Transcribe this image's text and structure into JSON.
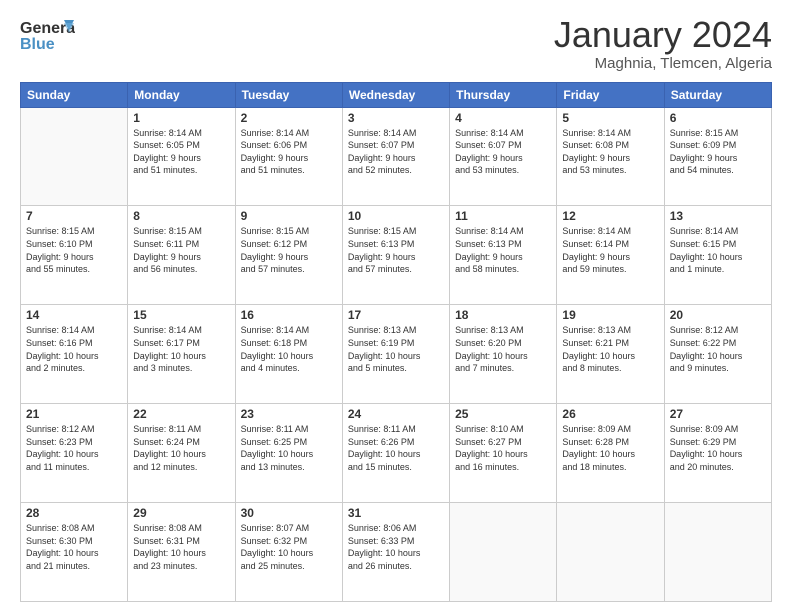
{
  "header": {
    "logo_line1": "General",
    "logo_line2": "Blue",
    "month_title": "January 2024",
    "location": "Maghnia, Tlemcen, Algeria"
  },
  "days_of_week": [
    "Sunday",
    "Monday",
    "Tuesday",
    "Wednesday",
    "Thursday",
    "Friday",
    "Saturday"
  ],
  "weeks": [
    [
      {
        "day": "",
        "info": ""
      },
      {
        "day": "1",
        "info": "Sunrise: 8:14 AM\nSunset: 6:05 PM\nDaylight: 9 hours\nand 51 minutes."
      },
      {
        "day": "2",
        "info": "Sunrise: 8:14 AM\nSunset: 6:06 PM\nDaylight: 9 hours\nand 51 minutes."
      },
      {
        "day": "3",
        "info": "Sunrise: 8:14 AM\nSunset: 6:07 PM\nDaylight: 9 hours\nand 52 minutes."
      },
      {
        "day": "4",
        "info": "Sunrise: 8:14 AM\nSunset: 6:07 PM\nDaylight: 9 hours\nand 53 minutes."
      },
      {
        "day": "5",
        "info": "Sunrise: 8:14 AM\nSunset: 6:08 PM\nDaylight: 9 hours\nand 53 minutes."
      },
      {
        "day": "6",
        "info": "Sunrise: 8:15 AM\nSunset: 6:09 PM\nDaylight: 9 hours\nand 54 minutes."
      }
    ],
    [
      {
        "day": "7",
        "info": "Sunrise: 8:15 AM\nSunset: 6:10 PM\nDaylight: 9 hours\nand 55 minutes."
      },
      {
        "day": "8",
        "info": "Sunrise: 8:15 AM\nSunset: 6:11 PM\nDaylight: 9 hours\nand 56 minutes."
      },
      {
        "day": "9",
        "info": "Sunrise: 8:15 AM\nSunset: 6:12 PM\nDaylight: 9 hours\nand 57 minutes."
      },
      {
        "day": "10",
        "info": "Sunrise: 8:15 AM\nSunset: 6:13 PM\nDaylight: 9 hours\nand 57 minutes."
      },
      {
        "day": "11",
        "info": "Sunrise: 8:14 AM\nSunset: 6:13 PM\nDaylight: 9 hours\nand 58 minutes."
      },
      {
        "day": "12",
        "info": "Sunrise: 8:14 AM\nSunset: 6:14 PM\nDaylight: 9 hours\nand 59 minutes."
      },
      {
        "day": "13",
        "info": "Sunrise: 8:14 AM\nSunset: 6:15 PM\nDaylight: 10 hours\nand 1 minute."
      }
    ],
    [
      {
        "day": "14",
        "info": "Sunrise: 8:14 AM\nSunset: 6:16 PM\nDaylight: 10 hours\nand 2 minutes."
      },
      {
        "day": "15",
        "info": "Sunrise: 8:14 AM\nSunset: 6:17 PM\nDaylight: 10 hours\nand 3 minutes."
      },
      {
        "day": "16",
        "info": "Sunrise: 8:14 AM\nSunset: 6:18 PM\nDaylight: 10 hours\nand 4 minutes."
      },
      {
        "day": "17",
        "info": "Sunrise: 8:13 AM\nSunset: 6:19 PM\nDaylight: 10 hours\nand 5 minutes."
      },
      {
        "day": "18",
        "info": "Sunrise: 8:13 AM\nSunset: 6:20 PM\nDaylight: 10 hours\nand 7 minutes."
      },
      {
        "day": "19",
        "info": "Sunrise: 8:13 AM\nSunset: 6:21 PM\nDaylight: 10 hours\nand 8 minutes."
      },
      {
        "day": "20",
        "info": "Sunrise: 8:12 AM\nSunset: 6:22 PM\nDaylight: 10 hours\nand 9 minutes."
      }
    ],
    [
      {
        "day": "21",
        "info": "Sunrise: 8:12 AM\nSunset: 6:23 PM\nDaylight: 10 hours\nand 11 minutes."
      },
      {
        "day": "22",
        "info": "Sunrise: 8:11 AM\nSunset: 6:24 PM\nDaylight: 10 hours\nand 12 minutes."
      },
      {
        "day": "23",
        "info": "Sunrise: 8:11 AM\nSunset: 6:25 PM\nDaylight: 10 hours\nand 13 minutes."
      },
      {
        "day": "24",
        "info": "Sunrise: 8:11 AM\nSunset: 6:26 PM\nDaylight: 10 hours\nand 15 minutes."
      },
      {
        "day": "25",
        "info": "Sunrise: 8:10 AM\nSunset: 6:27 PM\nDaylight: 10 hours\nand 16 minutes."
      },
      {
        "day": "26",
        "info": "Sunrise: 8:09 AM\nSunset: 6:28 PM\nDaylight: 10 hours\nand 18 minutes."
      },
      {
        "day": "27",
        "info": "Sunrise: 8:09 AM\nSunset: 6:29 PM\nDaylight: 10 hours\nand 20 minutes."
      }
    ],
    [
      {
        "day": "28",
        "info": "Sunrise: 8:08 AM\nSunset: 6:30 PM\nDaylight: 10 hours\nand 21 minutes."
      },
      {
        "day": "29",
        "info": "Sunrise: 8:08 AM\nSunset: 6:31 PM\nDaylight: 10 hours\nand 23 minutes."
      },
      {
        "day": "30",
        "info": "Sunrise: 8:07 AM\nSunset: 6:32 PM\nDaylight: 10 hours\nand 25 minutes."
      },
      {
        "day": "31",
        "info": "Sunrise: 8:06 AM\nSunset: 6:33 PM\nDaylight: 10 hours\nand 26 minutes."
      },
      {
        "day": "",
        "info": ""
      },
      {
        "day": "",
        "info": ""
      },
      {
        "day": "",
        "info": ""
      }
    ]
  ]
}
